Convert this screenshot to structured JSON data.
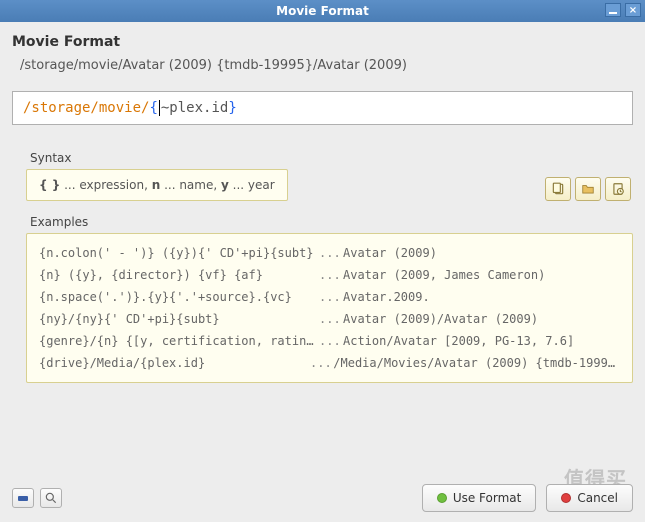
{
  "window": {
    "title": "Movie Format"
  },
  "header": {
    "title": "Movie Format",
    "preview": "/storage/movie/Avatar (2009) {tmdb-19995}/Avatar (2009)"
  },
  "input": {
    "prefix": "/storage/movie/",
    "brace_open": "{",
    "expression": " ~plex.id ",
    "brace_close": "}"
  },
  "syntax": {
    "label": "Syntax",
    "text_parts": {
      "p1": "{ }",
      "p2": " ... expression, ",
      "p3": "n",
      "p4": " ... name, ",
      "p5": "y",
      "p6": " ... year"
    }
  },
  "toolbar": {
    "icons": [
      "clipboard-icon",
      "folder-icon",
      "recent-icon"
    ]
  },
  "examples": {
    "label": "Examples",
    "rows": [
      {
        "pattern": "{n.colon(' - ')} ({y}){' CD'+pi}{subt}",
        "result": "Avatar (2009)"
      },
      {
        "pattern": "{n} ({y}, {director}) {vf} {af}",
        "result": "Avatar (2009, James Cameron)"
      },
      {
        "pattern": "{n.space('.')}.{y}{'.'+source}.{vc}",
        "result": "Avatar.2009."
      },
      {
        "pattern": "{ny}/{ny}{' CD'+pi}{subt}",
        "result": "Avatar (2009)/Avatar (2009)"
      },
      {
        "pattern": "{genre}/{n} {[y, certification, rating]}",
        "result": "Action/Avatar [2009, PG-13, 7.6]"
      },
      {
        "pattern": "{drive}/Media/{plex.id}",
        "result": "/Media/Movies/Avatar (2009) {tmdb-1999..."
      }
    ]
  },
  "footer": {
    "use_label": "Use Format",
    "cancel_label": "Cancel"
  },
  "watermark": "值得买"
}
